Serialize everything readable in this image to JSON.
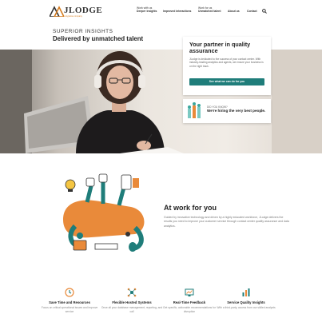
{
  "brand": {
    "name": "JLODGE",
    "tagline": "a Hypatos company",
    "accent_color": "#d47b1e",
    "teal_color": "#1f7d7a"
  },
  "nav": [
    {
      "line1": "Work with us",
      "line2": "Deeper insights"
    },
    {
      "line1": "",
      "line2": "Improved interactions"
    },
    {
      "line1": "Work for us",
      "line2": "Unmatched talent"
    },
    {
      "line1": "",
      "line2": "About us"
    },
    {
      "line1": "",
      "line2": "Contact"
    }
  ],
  "hero": {
    "eyebrow": "SUPERIOR INSIGHTS",
    "title": "Delivered by unmatched talent"
  },
  "quality_card": {
    "title": "Your partner in quality assurance",
    "body": "JLodge is dedicated to the success of your contact center. With industry-leading analytics and agents, we ensure your business is on the right track.",
    "button": "See what we can do for you"
  },
  "dyk_card": {
    "small": "DID YOU KNOW?",
    "big": "We're hiring the very best people."
  },
  "work": {
    "title": "At work for you",
    "body": "Guided by innovative technology and driven by a highly educated workforce, JLodge delivers the results you need to improve your customer service through contact center quality assurance and data analytics."
  },
  "features": [
    {
      "icon": "money-clock-icon",
      "title": "Save Time and Resources",
      "desc": "Focus on critical operational issues and improve service"
    },
    {
      "icon": "network-icon",
      "title": "Flexible Hosted Systems",
      "desc": "Once all your database management, reporting, and call"
    },
    {
      "icon": "monitor-chart-icon",
      "title": "Real-Time Feedback",
      "desc": "Get specific, actionable recommendations for disruption"
    },
    {
      "icon": "chart-bars-icon",
      "title": "Service Quality Insights",
      "desc": "With a third-party, access from our skilled analysts"
    }
  ]
}
